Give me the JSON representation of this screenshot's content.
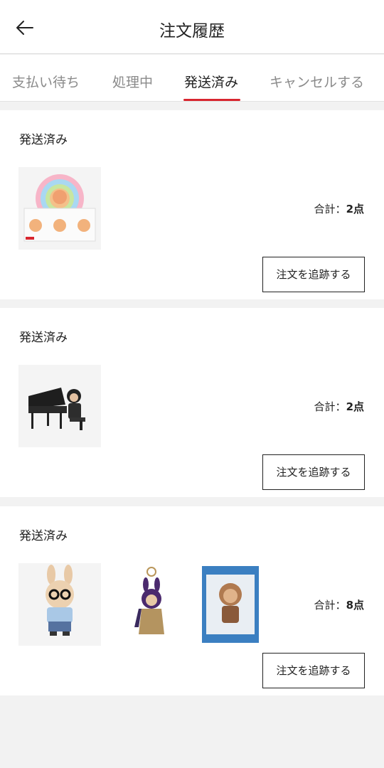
{
  "header": {
    "title": "注文履歴",
    "back_icon": "arrow-left-icon"
  },
  "tabs": [
    {
      "label": "支払い待ち",
      "active": false
    },
    {
      "label": "処理中",
      "active": false
    },
    {
      "label": "発送済み",
      "active": true
    },
    {
      "label": "キャンセルする",
      "active": false
    }
  ],
  "accent_color": "#d8262f",
  "orders": [
    {
      "status": "発送済み",
      "total_label": "合計：",
      "total_count": "2点",
      "track_label": "注文を追跡する",
      "products": [
        "boxed-figure-set-thumbnail"
      ]
    },
    {
      "status": "発送済み",
      "total_label": "合計：",
      "total_count": "2点",
      "track_label": "注文を追跡する",
      "products": [
        "piano-figure-thumbnail"
      ]
    },
    {
      "status": "発送済み",
      "total_label": "合計：",
      "total_count": "8点",
      "track_label": "注文を追跡する",
      "products": [
        "plush-figure-thumbnail",
        "keychain-figure-thumbnail",
        "boxed-figure-thumbnail"
      ]
    }
  ]
}
